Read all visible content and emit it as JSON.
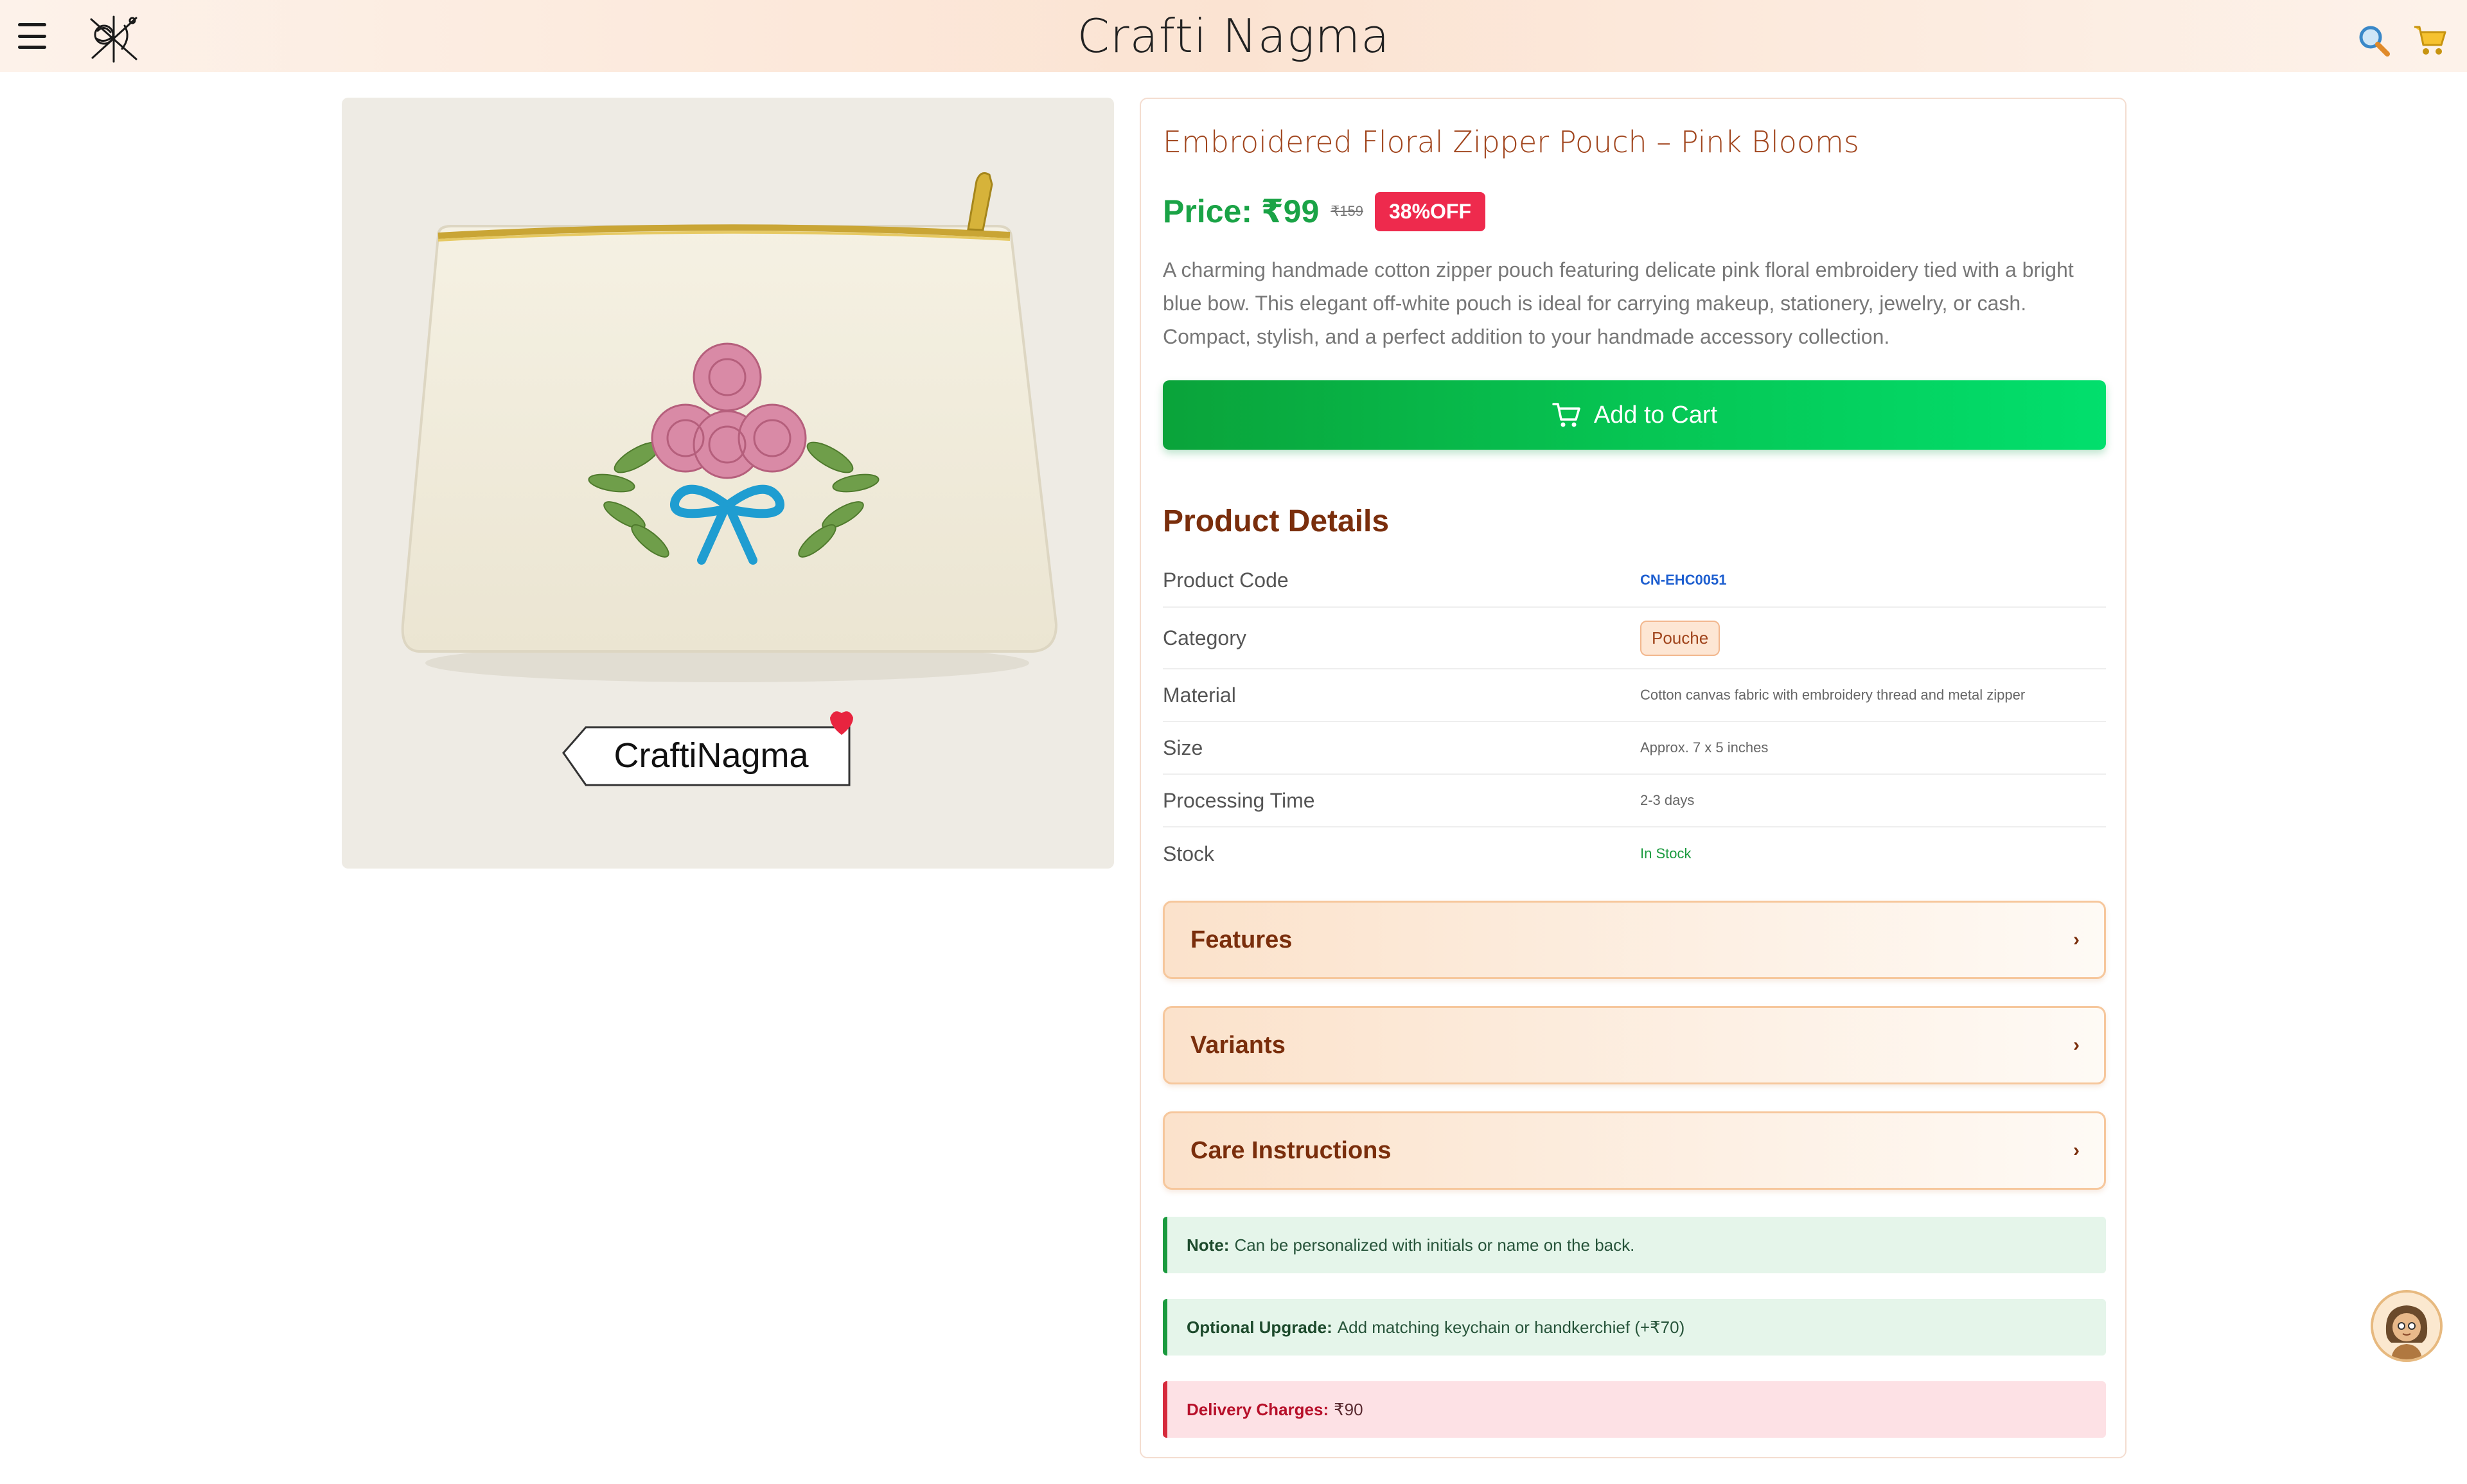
{
  "header": {
    "title": "Crafti Nagma"
  },
  "product": {
    "image_tag_text": "CraftiNagma",
    "title": "Embroidered Floral Zipper Pouch – Pink Blooms",
    "price_label": "Price: ₹99",
    "mrp": "₹159",
    "discount": "38%OFF",
    "description": "A charming handmade cotton zipper pouch featuring delicate pink floral embroidery tied with a bright blue bow. This elegant off-white pouch is ideal for carrying makeup, stationery, jewelry, or cash. Compact, stylish, and a perfect addition to your handmade accessory collection.",
    "add_to_cart_label": "Add to Cart"
  },
  "details": {
    "heading": "Product Details",
    "rows": [
      {
        "label": "Product Code",
        "value": "CN-EHC0051"
      },
      {
        "label": "Category",
        "value": "Pouche"
      },
      {
        "label": "Material",
        "value": "Cotton canvas fabric with embroidery thread and metal zipper"
      },
      {
        "label": "Size",
        "value": "Approx. 7 x 5 inches"
      },
      {
        "label": "Processing Time",
        "value": "2-3 days"
      },
      {
        "label": "Stock",
        "value": "In Stock"
      }
    ]
  },
  "accordions": [
    {
      "label": "Features",
      "chevron": "›"
    },
    {
      "label": "Variants",
      "chevron": "›"
    },
    {
      "label": "Care Instructions",
      "chevron": "›"
    }
  ],
  "notes": [
    {
      "label": "Note:",
      "text": "Can be personalized with initials or name on the back."
    },
    {
      "label": "Optional Upgrade:",
      "text": "Add matching keychain or handkerchief (+₹70)"
    },
    {
      "label": "Delivery Charges:",
      "text": "₹90"
    }
  ],
  "colors": {
    "price_green": "#1aa346",
    "brand_brown": "#7a2e0c",
    "discount_red": "#ee2a4d",
    "cart_green": "#06c553"
  },
  "icons": {
    "menu": "hamburger-menu-icon",
    "logo": "needle-yarn-logo",
    "search": "search-icon",
    "cart": "cart-icon",
    "assistant": "assistant-avatar"
  }
}
